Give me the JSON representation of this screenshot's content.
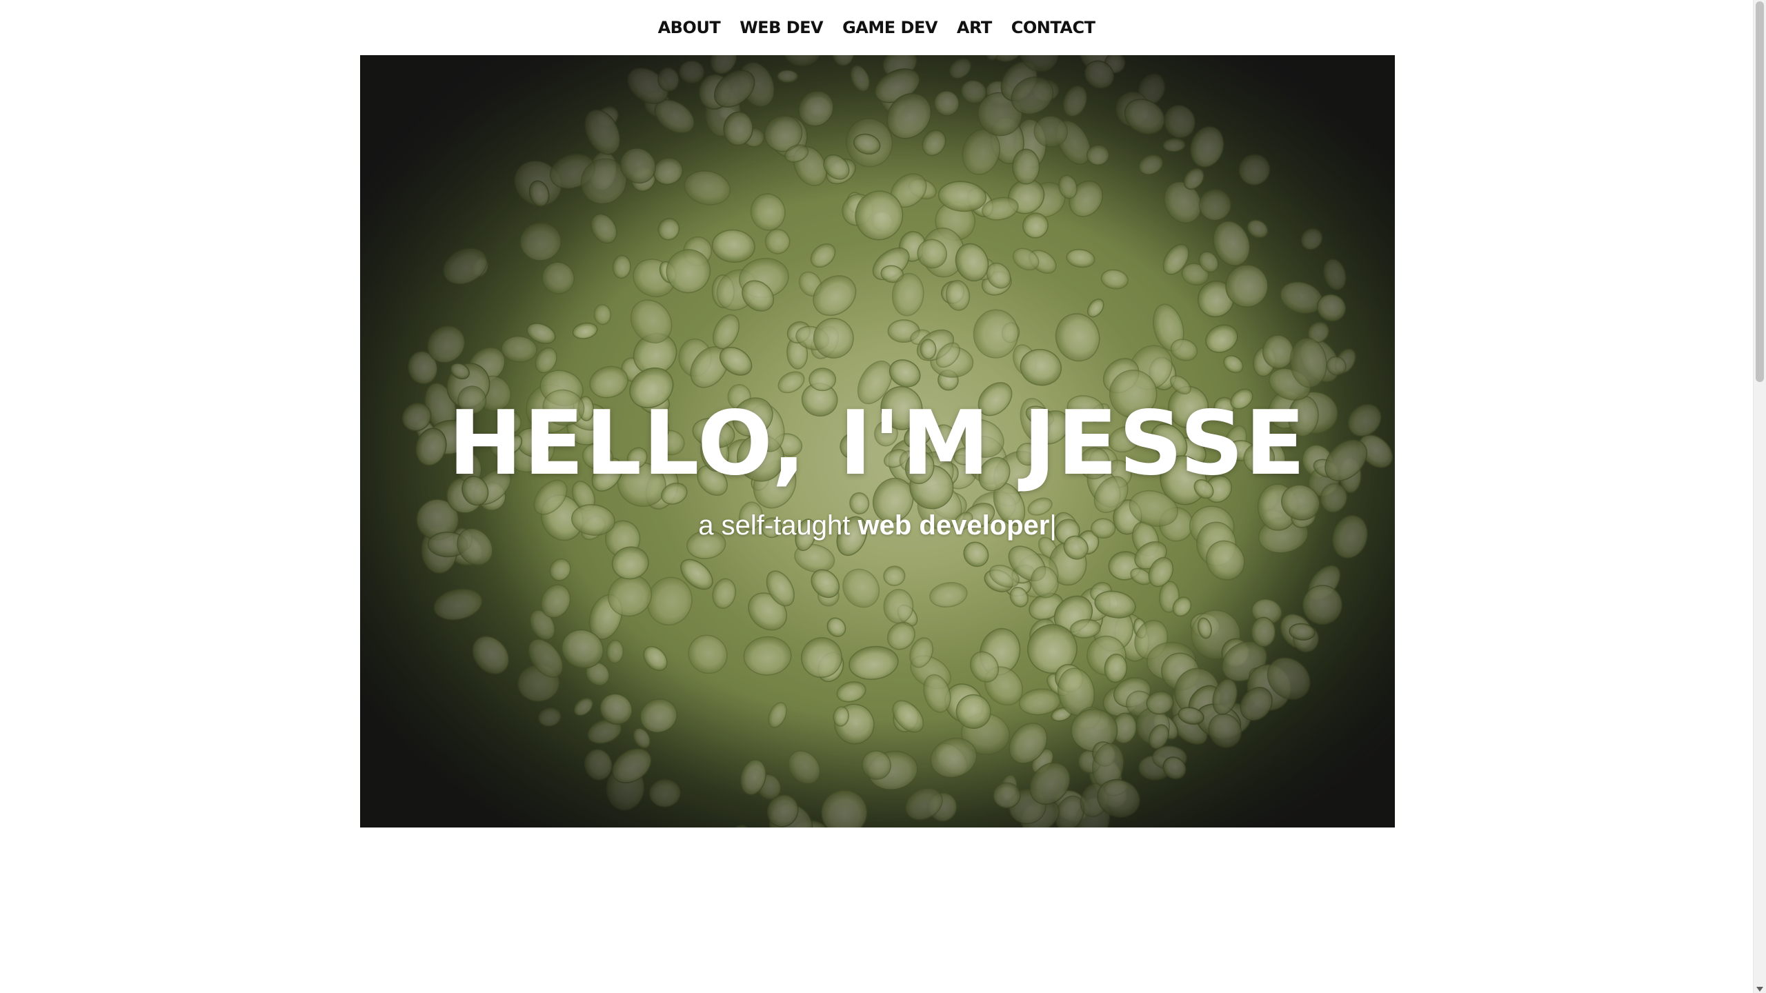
{
  "nav": {
    "items": [
      {
        "label": "ABOUT"
      },
      {
        "label": "WEB DEV"
      },
      {
        "label": "GAME DEV"
      },
      {
        "label": "ART"
      },
      {
        "label": "CONTACT"
      }
    ]
  },
  "hero": {
    "title": "HELLO, I'M JESSE",
    "subtitle_prefix": "a self-taught ",
    "subtitle_emphasis": "web developer",
    "cursor": "|",
    "image": "green hydrangea flower cluster"
  },
  "colors": {
    "nav_text": "#111111",
    "hero_text": "#ffffff",
    "background": "#ffffff"
  },
  "scrollbar": {
    "down_arrow_icon": "chevron-down-icon"
  }
}
